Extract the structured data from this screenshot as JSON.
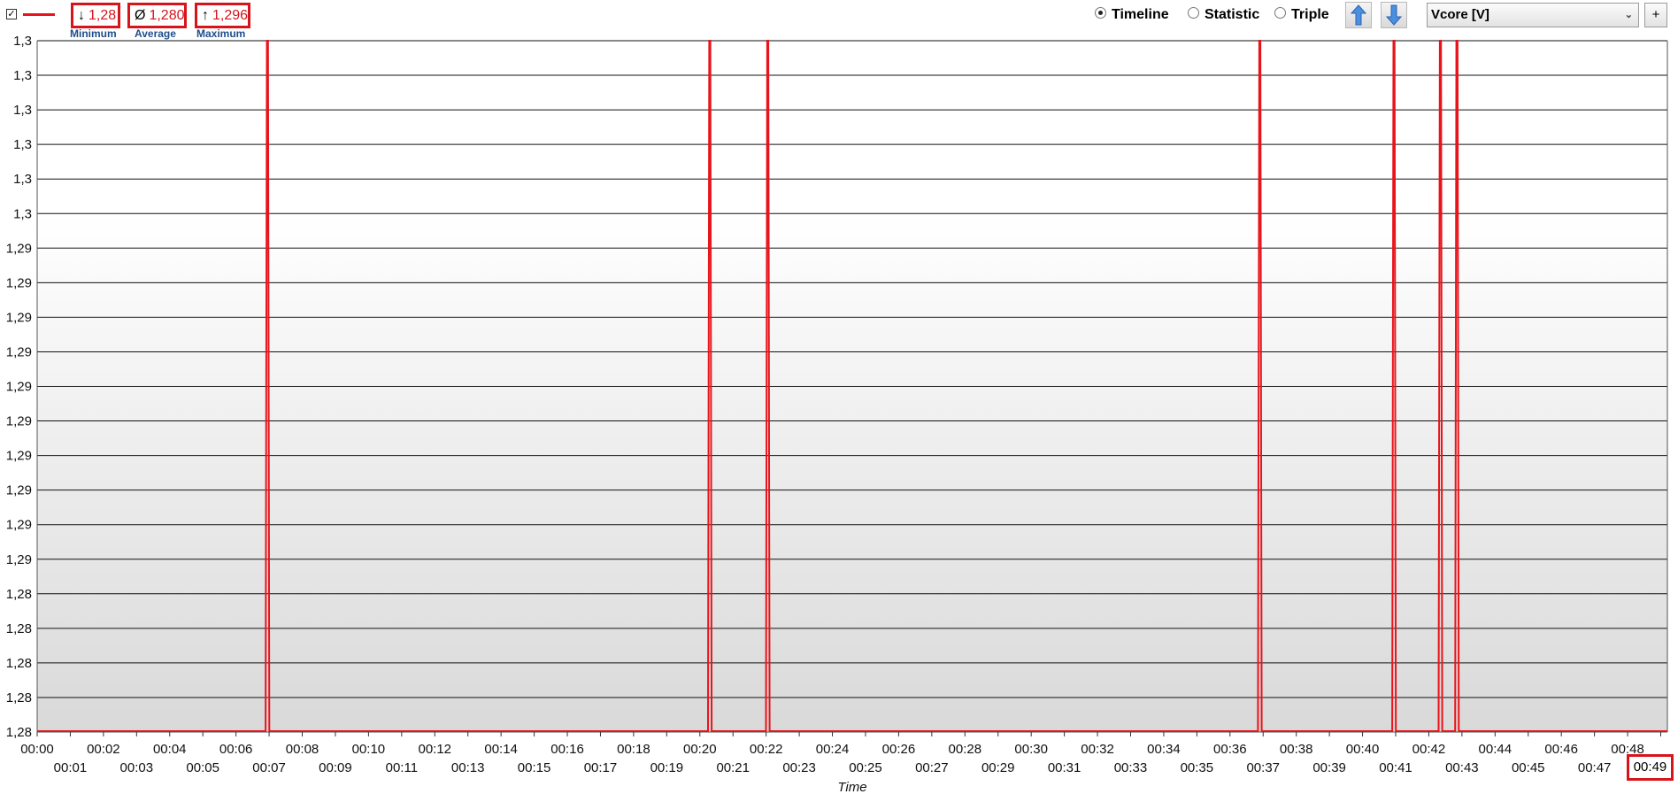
{
  "legend": {
    "checked": true,
    "line_color": "#e8141b",
    "checkbox_mark": "✓"
  },
  "stats": {
    "minimum": {
      "symbol": "↓",
      "value": "1,28",
      "label": "Minimum"
    },
    "average": {
      "symbol": "Ø",
      "value": "1,280",
      "label": "Average"
    },
    "maximum": {
      "symbol": "↑",
      "value": "1,296",
      "label": "Maximum"
    }
  },
  "view_mode": {
    "options": [
      "Timeline",
      "Statistic",
      "Triple"
    ],
    "selected": "Timeline"
  },
  "buttons": {
    "up_icon": "arrow-up-icon",
    "down_icon": "arrow-down-icon",
    "plus": "+"
  },
  "sensor_select": {
    "value": "Vcore [V]",
    "chevron": "⌄"
  },
  "colors": {
    "series": "#e8141b",
    "highlight_box": "#d7141c",
    "label_blue": "#1f4e8c"
  },
  "chart_data": {
    "type": "line",
    "xlabel": "Time",
    "ylabel": "",
    "ylim": [
      1.28,
      1.3
    ],
    "y_tick_labels": [
      "1,3",
      "1,3",
      "1,3",
      "1,3",
      "1,3",
      "1,3",
      "1,29",
      "1,29",
      "1,29",
      "1,29",
      "1,29",
      "1,29",
      "1,29",
      "1,29",
      "1,29",
      "1,29",
      "1,28",
      "1,28",
      "1,28",
      "1,28",
      "1,28"
    ],
    "x_tick_labels": [
      "00:00",
      "00:01",
      "00:02",
      "00:03",
      "00:04",
      "00:05",
      "00:06",
      "00:07",
      "00:08",
      "00:09",
      "00:10",
      "00:11",
      "00:12",
      "00:13",
      "00:14",
      "00:15",
      "00:16",
      "00:17",
      "00:18",
      "00:19",
      "00:20",
      "00:21",
      "00:22",
      "00:23",
      "00:24",
      "00:25",
      "00:26",
      "00:27",
      "00:28",
      "00:29",
      "00:30",
      "00:31",
      "00:32",
      "00:33",
      "00:34",
      "00:35",
      "00:36",
      "00:37",
      "00:38",
      "00:39",
      "00:40",
      "00:41",
      "00:42",
      "00:43",
      "00:44",
      "00:45",
      "00:46",
      "00:47",
      "00:48",
      "00:49"
    ],
    "grid": true,
    "series": [
      {
        "color": "#e8141b",
        "baseline": 1.28,
        "spikes": [
          {
            "time_min": 6.95,
            "value": 1.296
          },
          {
            "time_min": 20.3,
            "value": 1.296
          },
          {
            "time_min": 22.05,
            "value": 1.296
          },
          {
            "time_min": 36.9,
            "value": 1.296
          },
          {
            "time_min": 40.95,
            "value": 1.296
          },
          {
            "time_min": 42.35,
            "value": 1.296
          },
          {
            "time_min": 42.85,
            "value": 1.296
          }
        ]
      }
    ]
  }
}
